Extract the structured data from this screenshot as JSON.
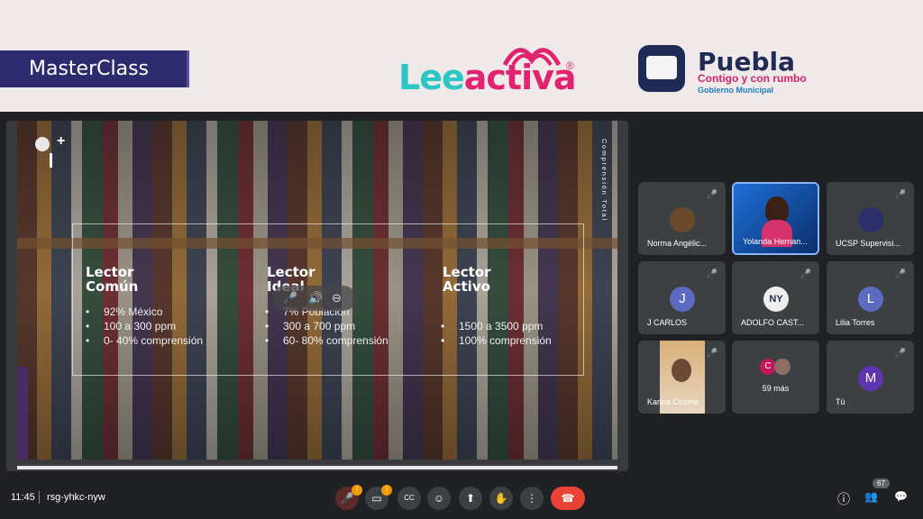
{
  "banner": {
    "masterclass": "MasterClass",
    "logo_lee_a": "Lee",
    "logo_lee_b": "activa",
    "logo_reg": "®",
    "puebla": "Puebla",
    "puebla_sub": "Contigo y con rumbo",
    "puebla_sub2": "Gobierno Municipal"
  },
  "slide": {
    "vertical_text": "Comprensión Total",
    "columns": [
      {
        "title1": "Lector",
        "title2": "Común",
        "bullets": [
          "92% México",
          "100 a 300 ppm",
          "0- 40% comprensión"
        ]
      },
      {
        "title1": "Lector",
        "title2": "Ideal",
        "bullets": [
          "7% Población",
          "300 a 700 ppm",
          "60- 80% comprensión"
        ]
      },
      {
        "title1": "Lector",
        "title2": "Activo",
        "bullets": [
          "1500 a 3500 ppm",
          "100% comprensión"
        ]
      }
    ],
    "bullet_char": "•"
  },
  "participants": [
    {
      "name": "Norma Angélic...",
      "avatar": "",
      "color": "#6b4a2b"
    },
    {
      "name": "Yolanda Hernan...",
      "avatar": "",
      "color": "#1e6fd9"
    },
    {
      "name": "UCSP Supervisi...",
      "avatar": "",
      "color": "#2b2f6b"
    },
    {
      "name": "J CARLOS",
      "avatar": "J",
      "color": "#5c6bc0"
    },
    {
      "name": "ADOLFO CAST...",
      "avatar": "NY",
      "color": "#eeeeee"
    },
    {
      "name": "Lilia Torres",
      "avatar": "L",
      "color": "#5c6bc0"
    },
    {
      "name": "Karina Cosme",
      "avatar": "",
      "color": "#b58a5a"
    },
    {
      "name": "59 más",
      "avatar": "C",
      "color": "#c2185b"
    },
    {
      "name": "Tú",
      "avatar": "M",
      "color": "#5e35b1"
    }
  ],
  "bottom": {
    "time": "11:45",
    "meeting_code": "rsg-yhkc-nyw",
    "badge": "!",
    "people_count": "67"
  },
  "icons": {
    "mic_off": "🎤",
    "volume": "🔊",
    "minus": "⊖",
    "cc": "CC",
    "emoji": "☺",
    "present": "⬆",
    "hand": "✋",
    "more": "⋮",
    "end": "☎",
    "info": "ⓘ",
    "people": "👥",
    "chat": "💬",
    "cam": "▭"
  }
}
